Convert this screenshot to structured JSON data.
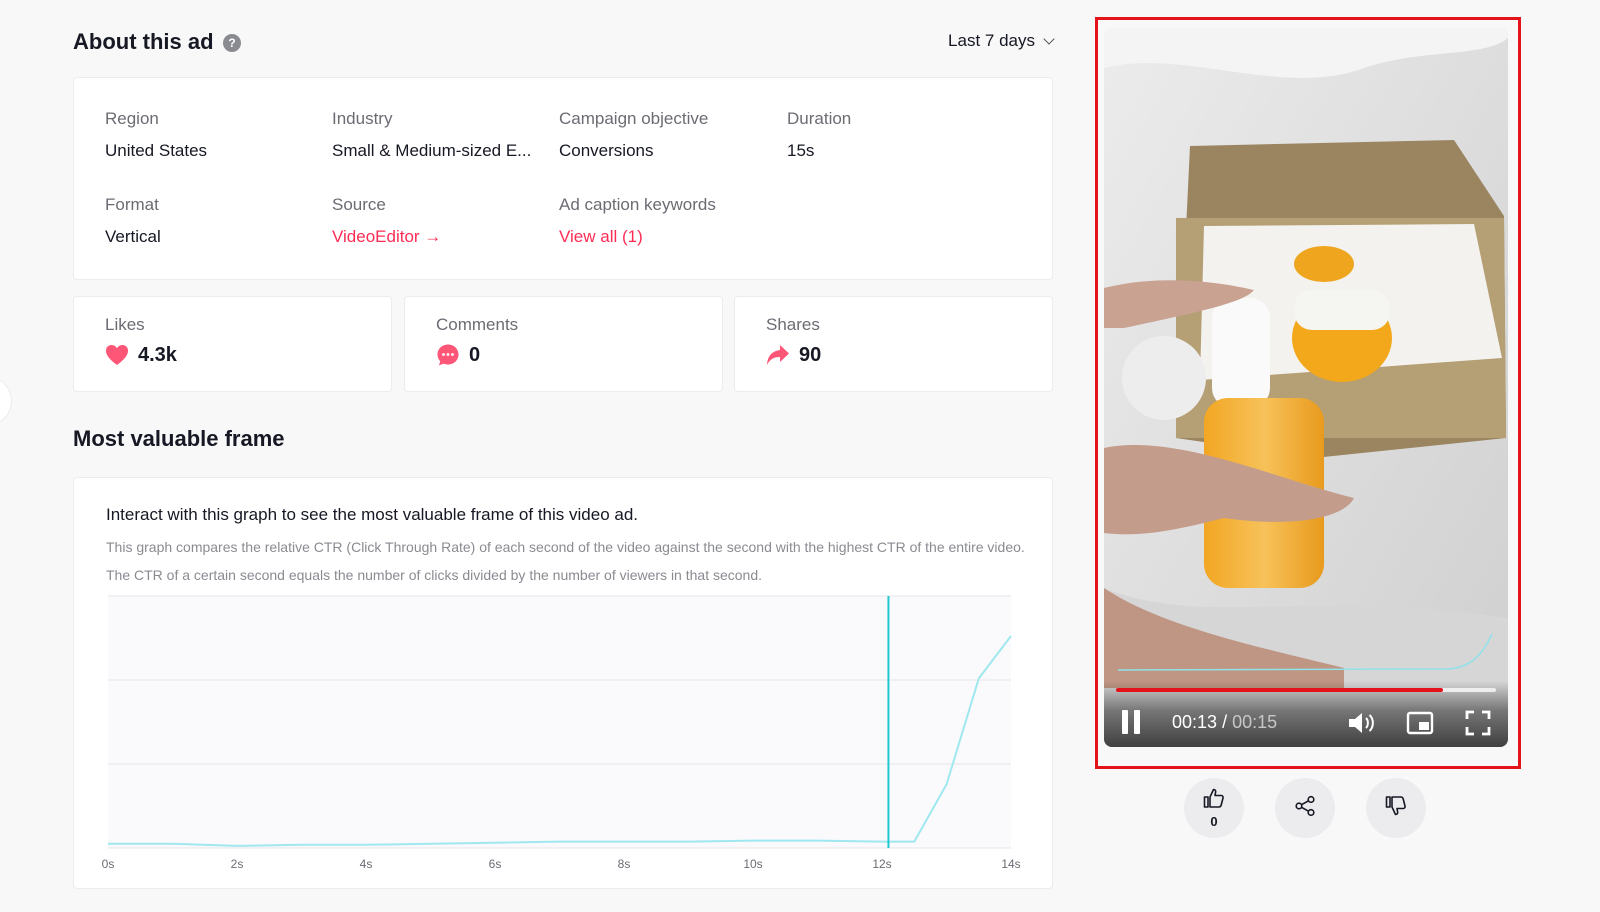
{
  "header": {
    "title": "About this ad",
    "help": "?",
    "range": "Last 7 days"
  },
  "info": {
    "region": {
      "label": "Region",
      "value": "United States"
    },
    "industry": {
      "label": "Industry",
      "value": "Small & Medium-sized E..."
    },
    "objective": {
      "label": "Campaign objective",
      "value": "Conversions"
    },
    "duration": {
      "label": "Duration",
      "value": "15s"
    },
    "format": {
      "label": "Format",
      "value": "Vertical"
    },
    "source": {
      "label": "Source",
      "value": "VideoEditor →"
    },
    "keywords": {
      "label": "Ad caption keywords",
      "value": "View all (1)"
    }
  },
  "stats": {
    "likes": {
      "label": "Likes",
      "value": "4.3k",
      "icon": "heart-icon"
    },
    "comments": {
      "label": "Comments",
      "value": "0",
      "icon": "comment-icon"
    },
    "shares": {
      "label": "Shares",
      "value": "90",
      "icon": "share-arrow-icon"
    }
  },
  "section": {
    "title": "Most valuable frame"
  },
  "chart": {
    "heading": "Interact with this graph to see the most valuable frame of this video ad.",
    "description": "This graph compares the relative CTR (Click Through Rate) of each second of the video against the second with the highest CTR of the entire video. The CTR of a certain second equals the number of clicks divided by the number of viewers in that second."
  },
  "chart_data": {
    "type": "line",
    "x": [
      0,
      1,
      2,
      3,
      4,
      5,
      6,
      7,
      8,
      9,
      10,
      11,
      12,
      12.5,
      13,
      13.5,
      14
    ],
    "x_tick_labels": [
      "0s",
      "2s",
      "4s",
      "6s",
      "8s",
      "10s",
      "12s",
      "14s"
    ],
    "x_ticks": [
      0,
      2,
      4,
      6,
      8,
      10,
      12,
      14
    ],
    "series": [
      {
        "values": [
          0.02,
          0.02,
          0.01,
          0.015,
          0.015,
          0.02,
          0.025,
          0.03,
          0.03,
          0.03,
          0.035,
          0.035,
          0.03,
          0.03,
          0.3,
          0.8,
          1.0
        ]
      }
    ],
    "ylim": [
      0,
      1.0
    ],
    "xlim": [
      0,
      14
    ],
    "marker_x": 12.1,
    "grid": true,
    "line_color": "#9fe8ef",
    "marker_color": "#1ec8d0"
  },
  "video": {
    "current_time": "00:13",
    "separator": "/",
    "total_time": "00:15",
    "progress": 0.86
  },
  "actions": {
    "like_count": "0"
  },
  "colors": {
    "accent": "#fe2c55",
    "highlight_border": "#e4131b"
  }
}
